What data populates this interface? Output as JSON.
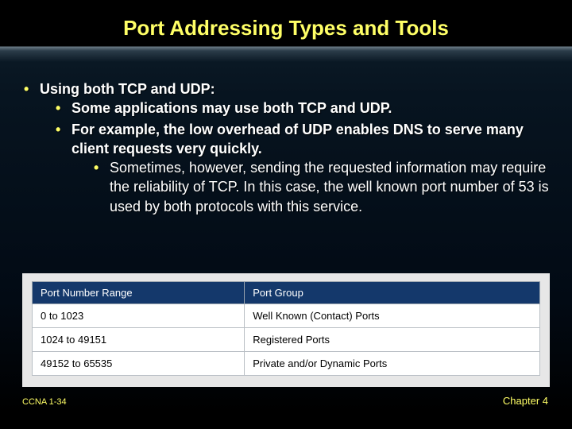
{
  "title": "Port Addressing Types and Tools",
  "bullets": {
    "l1": "Using both TCP and UDP:",
    "l2a": "Some applications may use both TCP and UDP.",
    "l2b": "For example, the low overhead of UDP enables DNS to serve many client requests very quickly.",
    "l3": "Sometimes, however, sending the requested information may require the reliability of TCP. In this case, the well known port number of 53 is used by both protocols with this service."
  },
  "table": {
    "headers": {
      "c1": "Port Number Range",
      "c2": "Port Group"
    },
    "rows": [
      {
        "c1": "0 to 1023",
        "c2": "Well Known (Contact) Ports"
      },
      {
        "c1": "1024 to 49151",
        "c2": "Registered Ports"
      },
      {
        "c1": "49152 to 65535",
        "c2": "Private and/or Dynamic Ports"
      }
    ]
  },
  "footer": {
    "left": "CCNA 1-34",
    "right": "Chapter 4"
  }
}
